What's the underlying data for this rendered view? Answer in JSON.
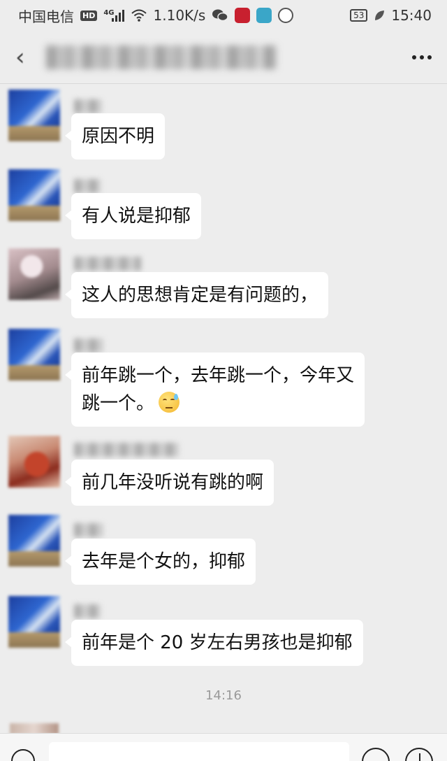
{
  "status_bar": {
    "carrier": "中国电信",
    "hd": "HD",
    "network": "4G",
    "speed": "1.10K/s",
    "battery": "53",
    "time": "15:40"
  },
  "chat": {
    "timestamp": "14:16"
  },
  "messages": [
    {
      "text": "原因不明",
      "avatar": "blue"
    },
    {
      "text": "有人说是抑郁",
      "avatar": "blue"
    },
    {
      "text": "这人的思想肯定是有问题的，",
      "avatar": "pink"
    },
    {
      "text_line1": "前年跳一个，去年跳一个，今年又",
      "text_line2": "跳一个。",
      "emoji": "sweat-smile-emoji",
      "avatar": "blue"
    },
    {
      "text": "前几年没听说有跳的啊",
      "avatar": "red"
    },
    {
      "text": "去年是个女的，抑郁",
      "avatar": "blue"
    },
    {
      "text": "前年是个 20 岁左右男孩也是抑郁",
      "avatar": "blue"
    }
  ]
}
